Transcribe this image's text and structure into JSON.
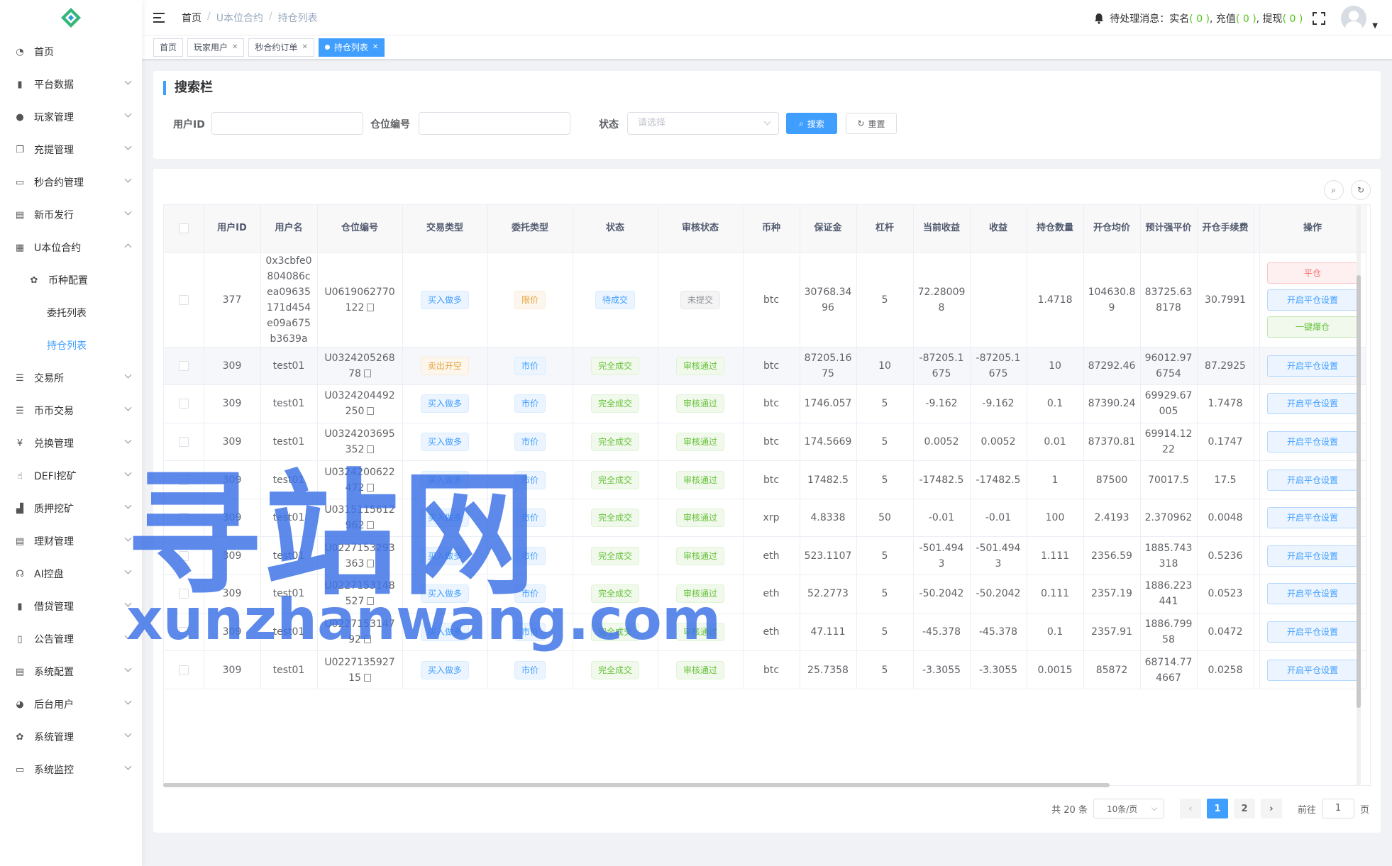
{
  "sidebar": {
    "items": [
      {
        "label": "首页",
        "icon": "dashboard-icon",
        "chev": ""
      },
      {
        "label": "平台数据",
        "icon": "book-icon",
        "chev": "down"
      },
      {
        "label": "玩家管理",
        "icon": "user-icon",
        "chev": "down"
      },
      {
        "label": "充提管理",
        "icon": "copy-icon",
        "chev": "down"
      },
      {
        "label": "秒合约管理",
        "icon": "monitor-icon",
        "chev": "down"
      },
      {
        "label": "新币发行",
        "icon": "ticket-icon",
        "chev": "down"
      },
      {
        "label": "U本位合约",
        "icon": "table-icon",
        "chev": "up"
      },
      {
        "label": "币种配置",
        "icon": "gear-icon",
        "chev": "",
        "level": 1
      },
      {
        "label": "委托列表",
        "icon": "",
        "chev": "",
        "level": 2
      },
      {
        "label": "持仓列表",
        "icon": "",
        "chev": "",
        "level": 2,
        "active": true
      },
      {
        "label": "交易所",
        "icon": "list-icon",
        "chev": "down"
      },
      {
        "label": "币币交易",
        "icon": "list-icon",
        "chev": "down"
      },
      {
        "label": "兑换管理",
        "icon": "yen-icon",
        "chev": "down"
      },
      {
        "label": "DEFI挖矿",
        "icon": "hand-icon",
        "chev": "down"
      },
      {
        "label": "质押挖矿",
        "icon": "bar-chart-icon",
        "chev": "down"
      },
      {
        "label": "理财管理",
        "icon": "document-icon",
        "chev": "down"
      },
      {
        "label": "AI控盘",
        "icon": "headset-icon",
        "chev": "down"
      },
      {
        "label": "借贷管理",
        "icon": "book-icon",
        "chev": "down"
      },
      {
        "label": "公告管理",
        "icon": "open-book-icon",
        "chev": "down"
      },
      {
        "label": "系统配置",
        "icon": "document-icon",
        "chev": "down"
      },
      {
        "label": "后台用户",
        "icon": "users-icon",
        "chev": "down"
      },
      {
        "label": "系统管理",
        "icon": "gear-icon",
        "chev": "down"
      },
      {
        "label": "系统监控",
        "icon": "monitor-icon",
        "chev": "down"
      }
    ]
  },
  "navbar": {
    "breadcrumb": [
      "首页",
      "U本位合约",
      "持仓列表"
    ],
    "notice_label": "待处理消息：",
    "n1": "实名",
    "n1v": "( 0 )",
    "n2": "充值",
    "n2v": "( 0 )",
    "n3": "提现",
    "n3v": "( 0 )"
  },
  "tags": [
    "首页",
    "玩家用户",
    "秒合约订单",
    "持仓列表"
  ],
  "search": {
    "title": "搜索栏",
    "user_id_label": "用户ID",
    "position_label": "仓位编号",
    "status_label": "状态",
    "status_placeholder": "请选择",
    "search_btn": "搜索",
    "reset_btn": "重置"
  },
  "table": {
    "headers": [
      "用户ID",
      "用户名",
      "仓位编号",
      "交易类型",
      "委托类型",
      "状态",
      "审核状态",
      "币种",
      "保证金",
      "杠杆",
      "当前收益",
      "收益",
      "持仓数量",
      "开仓均价",
      "预计强平价",
      "开仓手续费",
      "操作"
    ],
    "rows": [
      {
        "uid": "377",
        "name": "0x3cbfe0804086cea09635171d454e09a675b3639a",
        "pos": "U0619062770122",
        "trade": "买入做多",
        "tradeColor": "blue",
        "entrust": "限价",
        "entrustColor": "orange",
        "status": "待成交",
        "statusColor": "blue",
        "audit": "未提交",
        "auditColor": "gray",
        "coin": "btc",
        "margin": "30768.3496",
        "lev": "5",
        "cur": "72.280098",
        "profit": "",
        "qty": "1.4718",
        "avg": "104630.89",
        "liq": "83725.638178",
        "fee": "30.7991",
        "ops": [
          "平仓",
          "开启平仓设置",
          "一键爆仓"
        ]
      },
      {
        "uid": "309",
        "name": "test01",
        "pos": "U032420526878",
        "trade": "卖出开空",
        "tradeColor": "orange",
        "entrust": "市价",
        "entrustColor": "blue",
        "status": "完全成交",
        "statusColor": "green",
        "audit": "审核通过",
        "auditColor": "green",
        "coin": "btc",
        "margin": "87205.1675",
        "lev": "10",
        "cur": "-87205.1675",
        "profit": "-87205.1675",
        "qty": "10",
        "avg": "87292.46",
        "liq": "96012.976754",
        "fee": "87.2925",
        "ops": [
          "开启平仓设置"
        ]
      },
      {
        "uid": "309",
        "name": "test01",
        "pos": "U0324204492250",
        "trade": "买入做多",
        "tradeColor": "blue",
        "entrust": "市价",
        "entrustColor": "blue",
        "status": "完全成交",
        "statusColor": "green",
        "audit": "审核通过",
        "auditColor": "green",
        "coin": "btc",
        "margin": "1746.057",
        "lev": "5",
        "cur": "-9.162",
        "profit": "-9.162",
        "qty": "0.1",
        "avg": "87390.24",
        "liq": "69929.67005",
        "fee": "1.7478",
        "ops": [
          "开启平仓设置"
        ]
      },
      {
        "uid": "309",
        "name": "test01",
        "pos": "U0324203695352",
        "trade": "买入做多",
        "tradeColor": "blue",
        "entrust": "市价",
        "entrustColor": "blue",
        "status": "完全成交",
        "statusColor": "green",
        "audit": "审核通过",
        "auditColor": "green",
        "coin": "btc",
        "margin": "174.5669",
        "lev": "5",
        "cur": "0.0052",
        "profit": "0.0052",
        "qty": "0.01",
        "avg": "87370.81",
        "liq": "69914.1222",
        "fee": "0.1747",
        "ops": [
          "开启平仓设置"
        ]
      },
      {
        "uid": "309",
        "name": "test01",
        "pos": "U0324200622472",
        "trade": "买入做多",
        "tradeColor": "blue",
        "entrust": "市价",
        "entrustColor": "blue",
        "status": "完全成交",
        "statusColor": "green",
        "audit": "审核通过",
        "auditColor": "green",
        "coin": "btc",
        "margin": "17482.5",
        "lev": "5",
        "cur": "-17482.5",
        "profit": "-17482.5",
        "qty": "1",
        "avg": "87500",
        "liq": "70017.5",
        "fee": "17.5",
        "ops": [
          "开启平仓设置"
        ]
      },
      {
        "uid": "309",
        "name": "test01",
        "pos": "U0315115612962",
        "trade": "买入做多",
        "tradeColor": "blue",
        "entrust": "市价",
        "entrustColor": "blue",
        "status": "完全成交",
        "statusColor": "green",
        "audit": "审核通过",
        "auditColor": "green",
        "coin": "xrp",
        "margin": "4.8338",
        "lev": "50",
        "cur": "-0.01",
        "profit": "-0.01",
        "qty": "100",
        "avg": "2.4193",
        "liq": "2.370962",
        "fee": "0.0048",
        "ops": [
          "开启平仓设置"
        ]
      },
      {
        "uid": "309",
        "name": "test01",
        "pos": "U0227153293363",
        "trade": "买入做多",
        "tradeColor": "blue",
        "entrust": "市价",
        "entrustColor": "blue",
        "status": "完全成交",
        "statusColor": "green",
        "audit": "审核通过",
        "auditColor": "green",
        "coin": "eth",
        "margin": "523.1107",
        "lev": "5",
        "cur": "-501.4943",
        "profit": "-501.4943",
        "qty": "1.111",
        "avg": "2356.59",
        "liq": "1885.743318",
        "fee": "0.5236",
        "ops": [
          "开启平仓设置"
        ]
      },
      {
        "uid": "309",
        "name": "test01",
        "pos": "U0227153148527",
        "trade": "买入做多",
        "tradeColor": "blue",
        "entrust": "市价",
        "entrustColor": "blue",
        "status": "完全成交",
        "statusColor": "green",
        "audit": "审核通过",
        "auditColor": "green",
        "coin": "eth",
        "margin": "52.2773",
        "lev": "5",
        "cur": "-50.2042",
        "profit": "-50.2042",
        "qty": "0.111",
        "avg": "2357.19",
        "liq": "1886.223441",
        "fee": "0.0523",
        "ops": [
          "开启平仓设置"
        ]
      },
      {
        "uid": "309",
        "name": "test01",
        "pos": "U022715314792",
        "trade": "买入做多",
        "tradeColor": "blue",
        "entrust": "市价",
        "entrustColor": "blue",
        "status": "完全成交",
        "statusColor": "green",
        "audit": "审核通过",
        "auditColor": "green",
        "coin": "eth",
        "margin": "47.111",
        "lev": "5",
        "cur": "-45.378",
        "profit": "-45.378",
        "qty": "0.1",
        "avg": "2357.91",
        "liq": "1886.79958",
        "fee": "0.0472",
        "ops": [
          "开启平仓设置"
        ]
      },
      {
        "uid": "309",
        "name": "test01",
        "pos": "U022713592715",
        "trade": "买入做多",
        "tradeColor": "blue",
        "entrust": "市价",
        "entrustColor": "blue",
        "status": "完全成交",
        "statusColor": "green",
        "audit": "审核通过",
        "auditColor": "green",
        "coin": "btc",
        "margin": "25.7358",
        "lev": "5",
        "cur": "-3.3055",
        "profit": "-3.3055",
        "qty": "0.0015",
        "avg": "85872",
        "liq": "68714.774667",
        "fee": "0.0258",
        "ops": [
          "开启平仓设置"
        ]
      }
    ]
  },
  "pagination": {
    "total": "共 20 条",
    "page_size": "10条/页",
    "pages": [
      "1",
      "2"
    ],
    "goto_label": "前往",
    "goto_value": "1",
    "page_suffix": "页"
  },
  "watermark": {
    "line1": "寻站网",
    "line2": "xunzhanwang.com"
  }
}
